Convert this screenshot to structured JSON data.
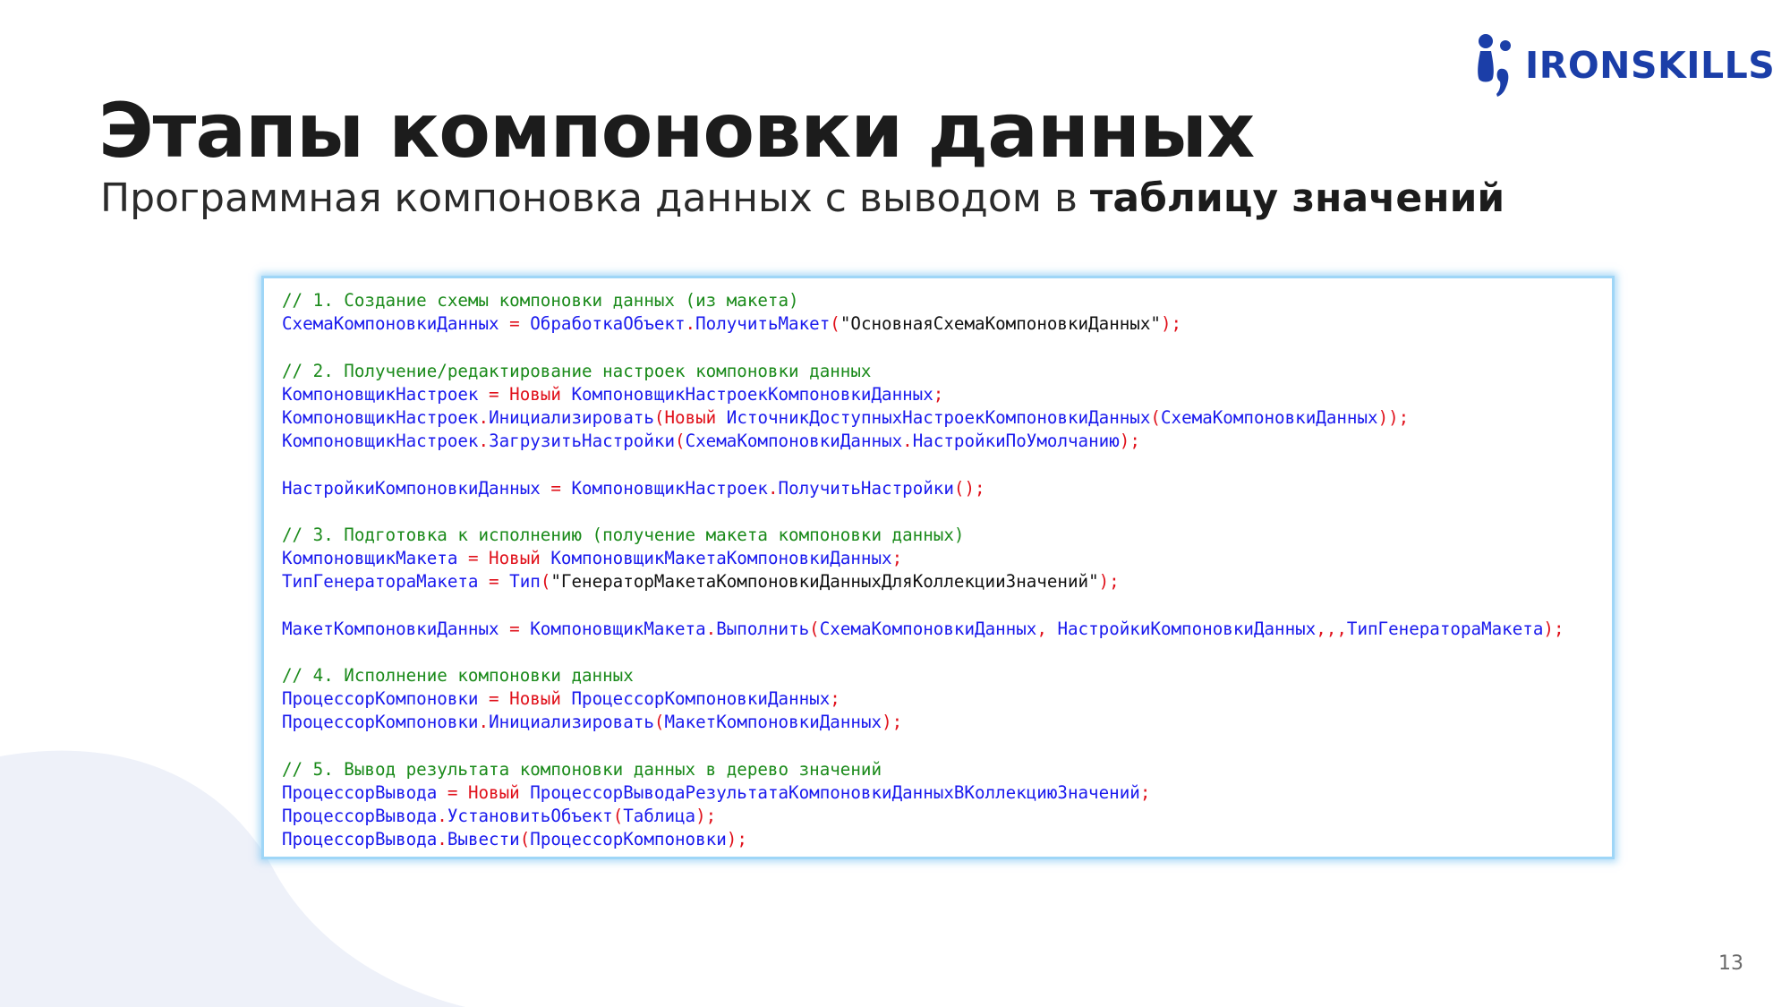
{
  "brand": {
    "name": "IRONSKILLS",
    "logo_icon": "ironskills-mark-icon",
    "color": "#1b3ea8"
  },
  "slide": {
    "title": "Этапы компоновки данных",
    "subtitle_regular": "Программная компоновка данных с выводом в",
    "subtitle_bold": "таблицу значений",
    "page_number": "13"
  },
  "colors": {
    "comment": "#1a8a1a",
    "keyword": "#e0101a",
    "identifier": "#1a1aee",
    "string": "#111111",
    "code_border": "#9fd6f7",
    "background_wave": "#eef1f9"
  },
  "code": [
    [
      {
        "t": "// 1. Создание схемы компоновки данных (из макета)",
        "c": "com"
      }
    ],
    [
      {
        "t": "СхемаКомпоновкиДанных",
        "c": "id"
      },
      {
        "t": " = ",
        "c": "op"
      },
      {
        "t": "ОбработкаОбъект",
        "c": "id"
      },
      {
        "t": ".",
        "c": "op"
      },
      {
        "t": "ПолучитьМакет",
        "c": "id"
      },
      {
        "t": "(",
        "c": "op"
      },
      {
        "t": "\"ОсновнаяСхемаКомпоновкиДанных\"",
        "c": "str"
      },
      {
        "t": ");",
        "c": "op"
      }
    ],
    [],
    [
      {
        "t": "// 2. Получение/редактирование настроек компоновки данных",
        "c": "com"
      }
    ],
    [
      {
        "t": "КомпоновщикНастроек",
        "c": "id"
      },
      {
        "t": " = ",
        "c": "op"
      },
      {
        "t": "Новый",
        "c": "kw"
      },
      {
        "t": " КомпоновщикНастроекКомпоновкиДанных",
        "c": "id"
      },
      {
        "t": ";",
        "c": "op"
      }
    ],
    [
      {
        "t": "КомпоновщикНастроек",
        "c": "id"
      },
      {
        "t": ".",
        "c": "op"
      },
      {
        "t": "Инициализировать",
        "c": "id"
      },
      {
        "t": "(",
        "c": "op"
      },
      {
        "t": "Новый",
        "c": "kw"
      },
      {
        "t": " ИсточникДоступныхНастроекКомпоновкиДанных",
        "c": "id"
      },
      {
        "t": "(",
        "c": "op"
      },
      {
        "t": "СхемаКомпоновкиДанных",
        "c": "id"
      },
      {
        "t": "));",
        "c": "op"
      }
    ],
    [
      {
        "t": "КомпоновщикНастроек",
        "c": "id"
      },
      {
        "t": ".",
        "c": "op"
      },
      {
        "t": "ЗагрузитьНастройки",
        "c": "id"
      },
      {
        "t": "(",
        "c": "op"
      },
      {
        "t": "СхемаКомпоновкиДанных",
        "c": "id"
      },
      {
        "t": ".",
        "c": "op"
      },
      {
        "t": "НастройкиПоУмолчанию",
        "c": "id"
      },
      {
        "t": ");",
        "c": "op"
      }
    ],
    [],
    [
      {
        "t": "НастройкиКомпоновкиДанных",
        "c": "id"
      },
      {
        "t": " = ",
        "c": "op"
      },
      {
        "t": "КомпоновщикНастроек",
        "c": "id"
      },
      {
        "t": ".",
        "c": "op"
      },
      {
        "t": "ПолучитьНастройки",
        "c": "id"
      },
      {
        "t": "();",
        "c": "op"
      }
    ],
    [],
    [
      {
        "t": "// 3. Подготовка к исполнению (получение макета компоновки данных)",
        "c": "com"
      }
    ],
    [
      {
        "t": "КомпоновщикМакета",
        "c": "id"
      },
      {
        "t": " = ",
        "c": "op"
      },
      {
        "t": "Новый",
        "c": "kw"
      },
      {
        "t": " КомпоновщикМакетаКомпоновкиДанных",
        "c": "id"
      },
      {
        "t": ";",
        "c": "op"
      }
    ],
    [
      {
        "t": "ТипГенератораМакета",
        "c": "id"
      },
      {
        "t": " = ",
        "c": "op"
      },
      {
        "t": "Тип",
        "c": "id"
      },
      {
        "t": "(",
        "c": "op"
      },
      {
        "t": "\"ГенераторМакетаКомпоновкиДанныхДляКоллекцииЗначений\"",
        "c": "str"
      },
      {
        "t": ");",
        "c": "op"
      }
    ],
    [],
    [
      {
        "t": "МакетКомпоновкиДанных",
        "c": "id"
      },
      {
        "t": " = ",
        "c": "op"
      },
      {
        "t": "КомпоновщикМакета",
        "c": "id"
      },
      {
        "t": ".",
        "c": "op"
      },
      {
        "t": "Выполнить",
        "c": "id"
      },
      {
        "t": "(",
        "c": "op"
      },
      {
        "t": "СхемаКомпоновкиДанных",
        "c": "id"
      },
      {
        "t": ", ",
        "c": "op"
      },
      {
        "t": "НастройкиКомпоновкиДанных",
        "c": "id"
      },
      {
        "t": ",,,",
        "c": "op"
      },
      {
        "t": "ТипГенератораМакета",
        "c": "id"
      },
      {
        "t": ");",
        "c": "op"
      }
    ],
    [],
    [
      {
        "t": "// 4. Исполнение компоновки данных",
        "c": "com"
      }
    ],
    [
      {
        "t": "ПроцессорКомпоновки",
        "c": "id"
      },
      {
        "t": " = ",
        "c": "op"
      },
      {
        "t": "Новый",
        "c": "kw"
      },
      {
        "t": " ПроцессорКомпоновкиДанных",
        "c": "id"
      },
      {
        "t": ";",
        "c": "op"
      }
    ],
    [
      {
        "t": "ПроцессорКомпоновки",
        "c": "id"
      },
      {
        "t": ".",
        "c": "op"
      },
      {
        "t": "Инициализировать",
        "c": "id"
      },
      {
        "t": "(",
        "c": "op"
      },
      {
        "t": "МакетКомпоновкиДанных",
        "c": "id"
      },
      {
        "t": ");",
        "c": "op"
      }
    ],
    [],
    [
      {
        "t": "// 5. Вывод результата компоновки данных в дерево значений",
        "c": "com"
      }
    ],
    [
      {
        "t": "ПроцессорВывода",
        "c": "id"
      },
      {
        "t": " = ",
        "c": "op"
      },
      {
        "t": "Новый",
        "c": "kw"
      },
      {
        "t": " ПроцессорВыводаРезультатаКомпоновкиДанныхВКоллекциюЗначений",
        "c": "id"
      },
      {
        "t": ";",
        "c": "op"
      }
    ],
    [
      {
        "t": "ПроцессорВывода",
        "c": "id"
      },
      {
        "t": ".",
        "c": "op"
      },
      {
        "t": "УстановитьОбъект",
        "c": "id"
      },
      {
        "t": "(",
        "c": "op"
      },
      {
        "t": "Таблица",
        "c": "id"
      },
      {
        "t": ");",
        "c": "op"
      }
    ],
    [
      {
        "t": "ПроцессорВывода",
        "c": "id"
      },
      {
        "t": ".",
        "c": "op"
      },
      {
        "t": "Вывести",
        "c": "id"
      },
      {
        "t": "(",
        "c": "op"
      },
      {
        "t": "ПроцессорКомпоновки",
        "c": "id"
      },
      {
        "t": ");",
        "c": "op"
      }
    ]
  ]
}
